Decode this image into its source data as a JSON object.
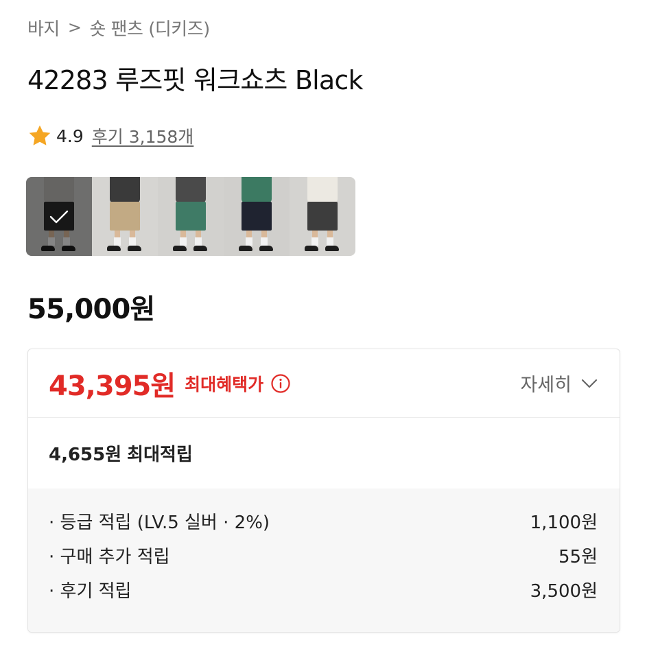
{
  "breadcrumb": {
    "items": [
      "바지",
      "숏 팬츠 (디키즈)"
    ],
    "separator": ">"
  },
  "product": {
    "title": "42283 루즈핏 워크쇼츠 Black",
    "rating": "4.9",
    "review_link": "후기 3,158개",
    "price": "55,000원"
  },
  "thumbnails": [
    {
      "name": "Black",
      "selected": true,
      "shirt_color": "#b8b6b2",
      "shorts_color": "#2a2a2a",
      "bg_color": "#c9c8c6"
    },
    {
      "name": "Khaki",
      "selected": false,
      "shirt_color": "#3a3a3a",
      "shorts_color": "#c2aa84",
      "bg_color": "#d6d5d2"
    },
    {
      "name": "Green",
      "selected": false,
      "shirt_color": "#4a4a4a",
      "shorts_color": "#3f7b66",
      "bg_color": "#d2d1ce"
    },
    {
      "name": "Navy",
      "selected": false,
      "shirt_color": "#3c7a62",
      "shorts_color": "#1f2330",
      "bg_color": "#d0cfcc"
    },
    {
      "name": "Charcoal",
      "selected": false,
      "shirt_color": "#ece9e2",
      "shorts_color": "#3d3d3d",
      "bg_color": "#d4d3d0"
    }
  ],
  "benefit": {
    "sale_price": "43,395원",
    "label": "최대혜택가",
    "detail_toggle": "자세히",
    "points_amount": "4,655원",
    "points_label": "최대적립",
    "rows": [
      {
        "label": "· 등급 적립 (LV.5 실버 · 2%)",
        "amount": "1,100원"
      },
      {
        "label": "· 구매 추가 적립",
        "amount": "55원"
      },
      {
        "label": "· 후기 적립",
        "amount": "3,500원"
      }
    ]
  },
  "colors": {
    "accent_red": "#e12b27",
    "star": "#f5a623",
    "muted_text": "#777777"
  },
  "icons": {
    "star": "star-icon",
    "info": "info-icon",
    "chevron": "chevron-down-icon",
    "check": "check-icon"
  }
}
